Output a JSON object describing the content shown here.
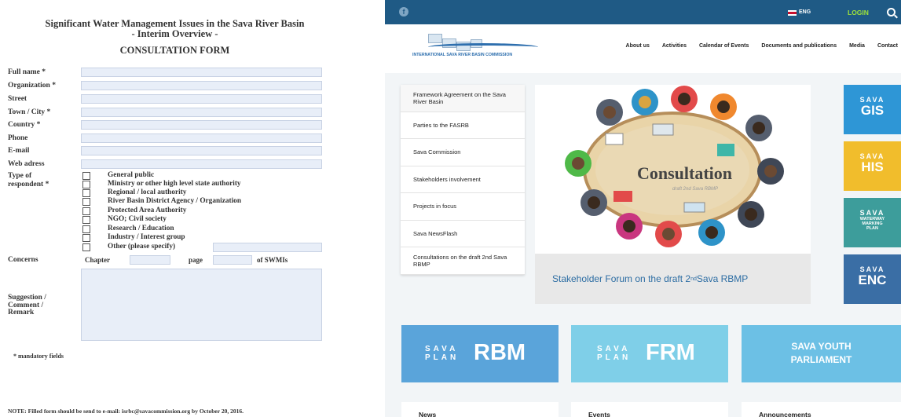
{
  "document": {
    "title_line1": "Significant Water Management Issues in the Sava River Basin",
    "title_line2": "- Interim Overview -",
    "form_title": "CONSULTATION FORM",
    "fields": [
      {
        "label": "Full name *"
      },
      {
        "label": "Organization *"
      },
      {
        "label": "Street"
      },
      {
        "label": "Town / City *"
      },
      {
        "label": "Country *"
      },
      {
        "label": "Phone"
      },
      {
        "label": "E-mail"
      },
      {
        "label": "Web adress"
      }
    ],
    "respondent_label_1": "Type of",
    "respondent_label_2": "respondent *",
    "respondent_options": [
      "General public",
      "Ministry or other high level state authority",
      "Regional / local authority",
      "River Basin District Agency / Organization",
      "Protected Area Authority",
      "NGO; Civil society",
      "Research / Education",
      "Industry / Interest group",
      "Other (please specify)"
    ],
    "concerns_label": "Concerns",
    "chapter_label": "Chapter",
    "page_label": "page",
    "of_label": "of SWMIs",
    "suggestion_label_1": "Suggestion /",
    "suggestion_label_2": "Comment /",
    "suggestion_label_3": "Remark",
    "mandatory_note": "* mandatory fields",
    "note": "NOTE: Filled form should be send to e-mail: isrbc@savacommission.org by October 20, 2016."
  },
  "site": {
    "topbar": {
      "social_icon": "facebook-icon",
      "social_glyph": "f",
      "language": "ENG",
      "login": "LOGIN",
      "search_icon": "search-icon"
    },
    "logo_text": "INTERNATIONAL SAVA RIVER BASIN COMMISSION",
    "nav": [
      "About us",
      "Activities",
      "Calendar of Events",
      "Documents and publications",
      "Media",
      "Contact"
    ],
    "side_menu": [
      "Framework Agreement on the Sava River Basin",
      "Parties to the FASRB",
      "Sava Commission",
      "Stakeholders involvement",
      "Projects in focus",
      "Sava NewsFlash",
      "Consultations on the draft 2nd Sava RBMP"
    ],
    "hero": {
      "art_title": "Consultation",
      "art_subtitle": "draft 2nd Sava RBMP",
      "caption_pre": "Stakeholder Forum on the draft 2",
      "caption_sup": "nd",
      "caption_post": " Sava RBMP"
    },
    "tiles": [
      {
        "small": "SAVA",
        "large": "GIS",
        "color": "#2e96d6"
      },
      {
        "small": "SAVA",
        "large": "HIS",
        "color": "#f1bd2c"
      },
      {
        "small": "SAVA",
        "medium": [
          "WATERWAY",
          "MARKING",
          "PLAN"
        ],
        "color": "#3d9d9b"
      },
      {
        "small": "SAVA",
        "large": "ENC",
        "color": "#3a6ea5"
      }
    ],
    "banners": [
      {
        "small1": "SAVA",
        "small2": "PLAN",
        "large": "RBM",
        "color": "#5aa4da"
      },
      {
        "small1": "SAVA",
        "small2": "PLAN",
        "large": "FRM",
        "color": "#7fcfe8"
      },
      {
        "line1": "SAVA YOUTH",
        "line2": "PARLIAMENT",
        "color": "#6cc0e5"
      }
    ],
    "cards": [
      "News",
      "Events",
      "Announcements"
    ],
    "colors": {
      "topbar": "#1f5a85",
      "login": "#9fe23a",
      "link": "#2d6da3"
    }
  }
}
